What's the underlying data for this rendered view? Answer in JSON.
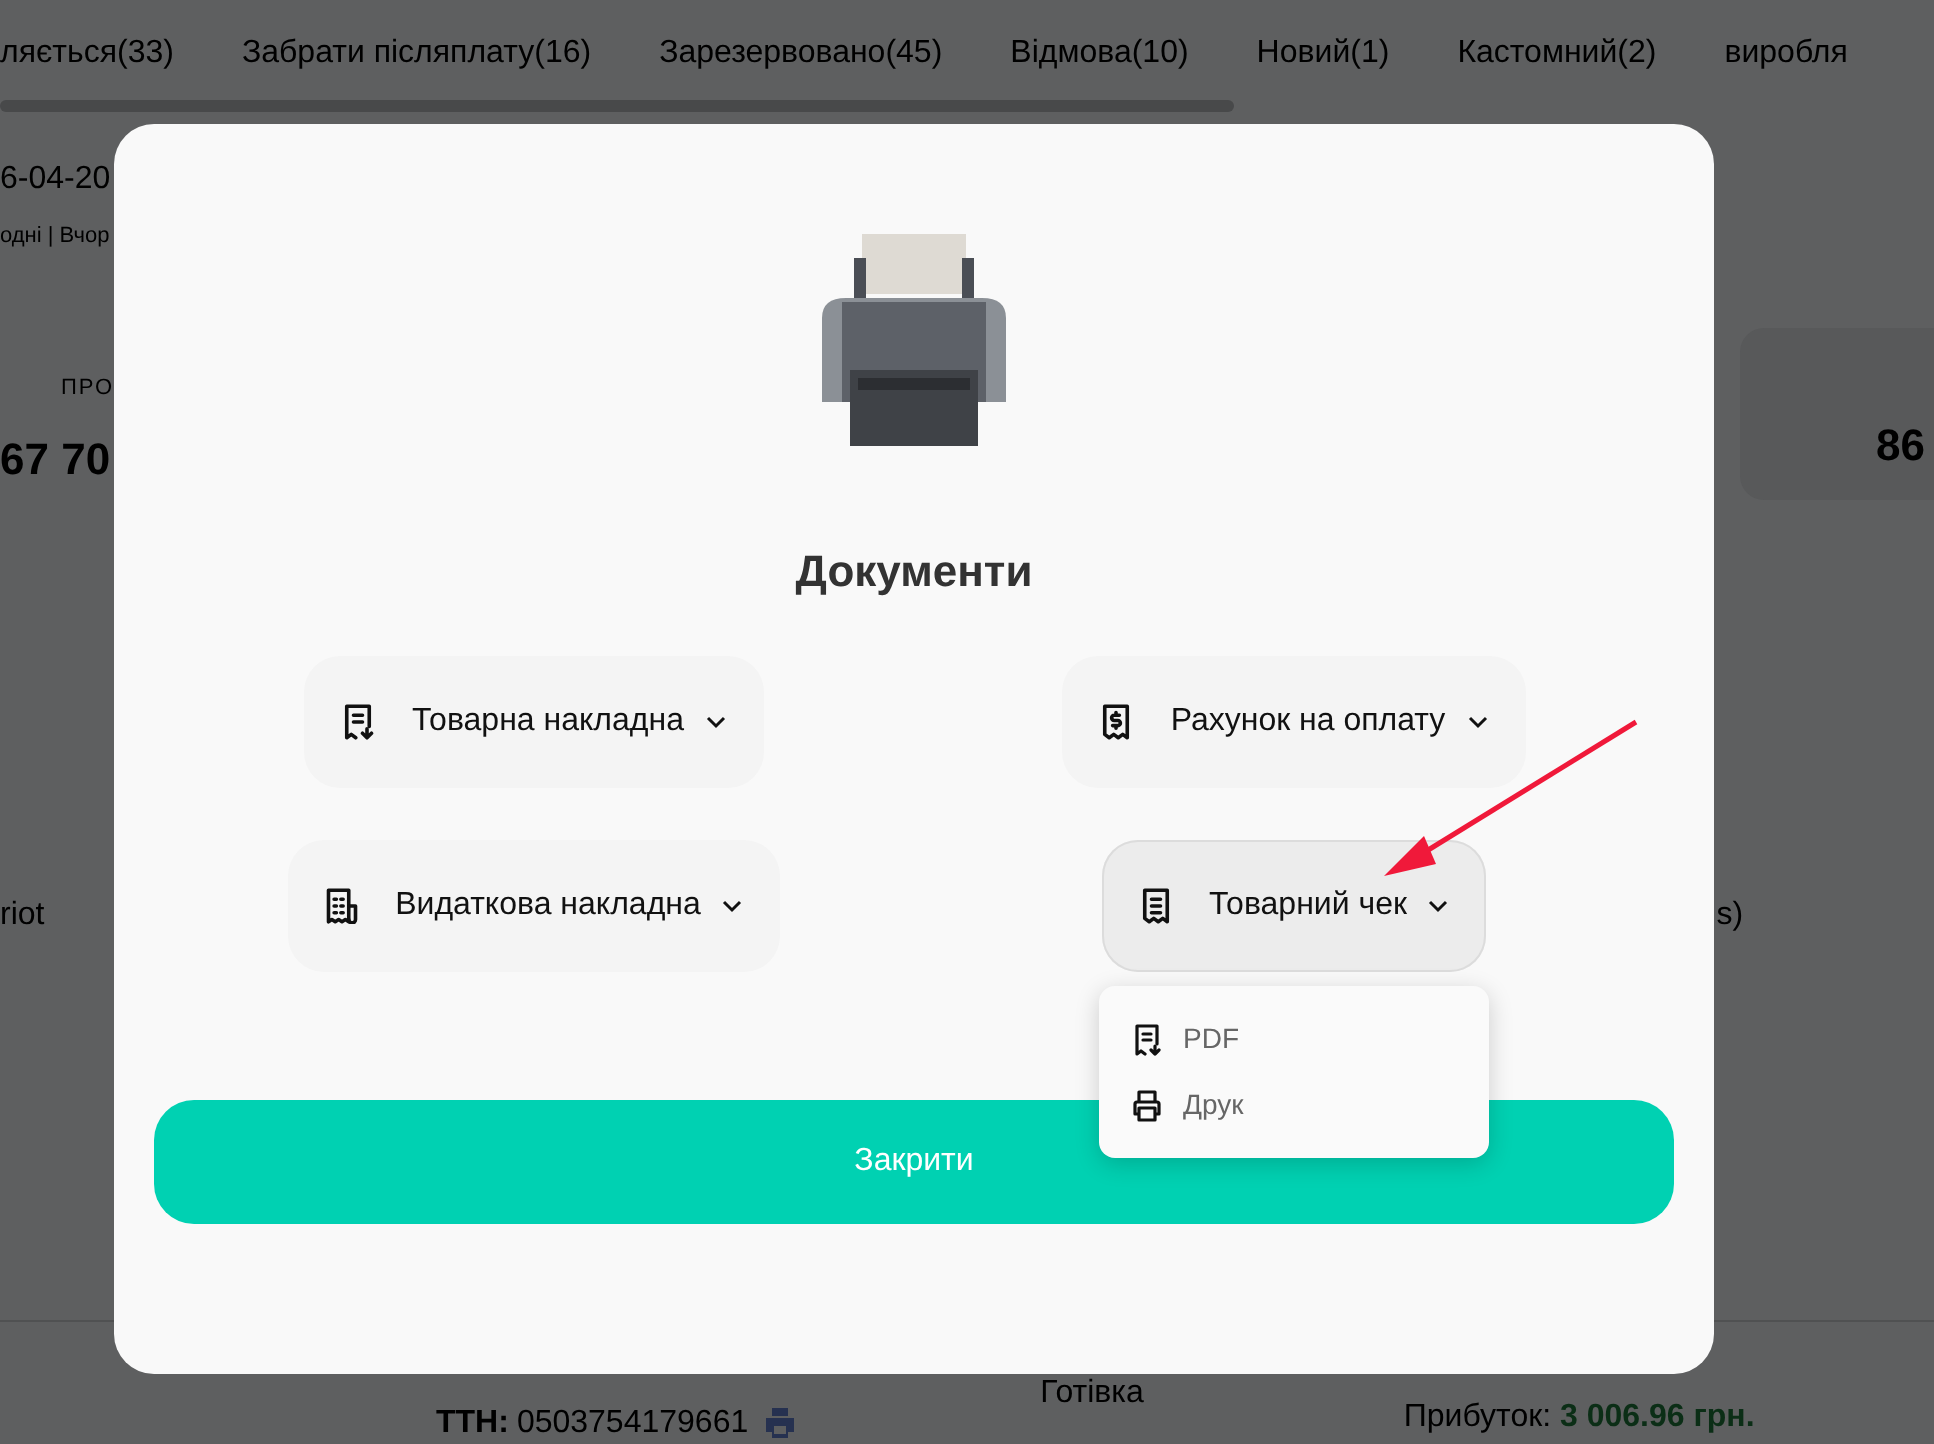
{
  "background": {
    "tabs": [
      {
        "label": "ляється(33)"
      },
      {
        "label": "Забрати післяплату(16)"
      },
      {
        "label": "Зарезервовано(45)"
      },
      {
        "label": "Відмова(10)"
      },
      {
        "label": "Новий(1)"
      },
      {
        "label": "Кастомний(2)"
      },
      {
        "label": "виробля"
      }
    ],
    "date_fragment": "6-04-20",
    "quick_links": "одні | Вчор",
    "stat_left": {
      "label": "ПРО",
      "value": "67 70"
    },
    "stat_right": {
      "value": "86"
    },
    "row_fragment_left": "riot",
    "row_fragment_right": "s)",
    "ttn": {
      "label": "ТТН:",
      "value": "0503754179661"
    },
    "payment": "Готівка",
    "profit": {
      "label": "Прибуток:",
      "value": "3 006.96 грн."
    }
  },
  "modal": {
    "title": "Документи",
    "documents": [
      {
        "label": "Товарна накладна",
        "kind": "invoice",
        "expanded": false
      },
      {
        "label": "Рахунок на оплату",
        "kind": "bill",
        "expanded": false
      },
      {
        "label": "Видаткова накладна",
        "kind": "waybill",
        "expanded": false
      },
      {
        "label": "Товарний чек",
        "kind": "receipt",
        "expanded": true,
        "menu": [
          {
            "label": "PDF",
            "kind": "pdf"
          },
          {
            "label": "Друк",
            "kind": "print"
          }
        ]
      }
    ],
    "close_button": "Закрити"
  }
}
